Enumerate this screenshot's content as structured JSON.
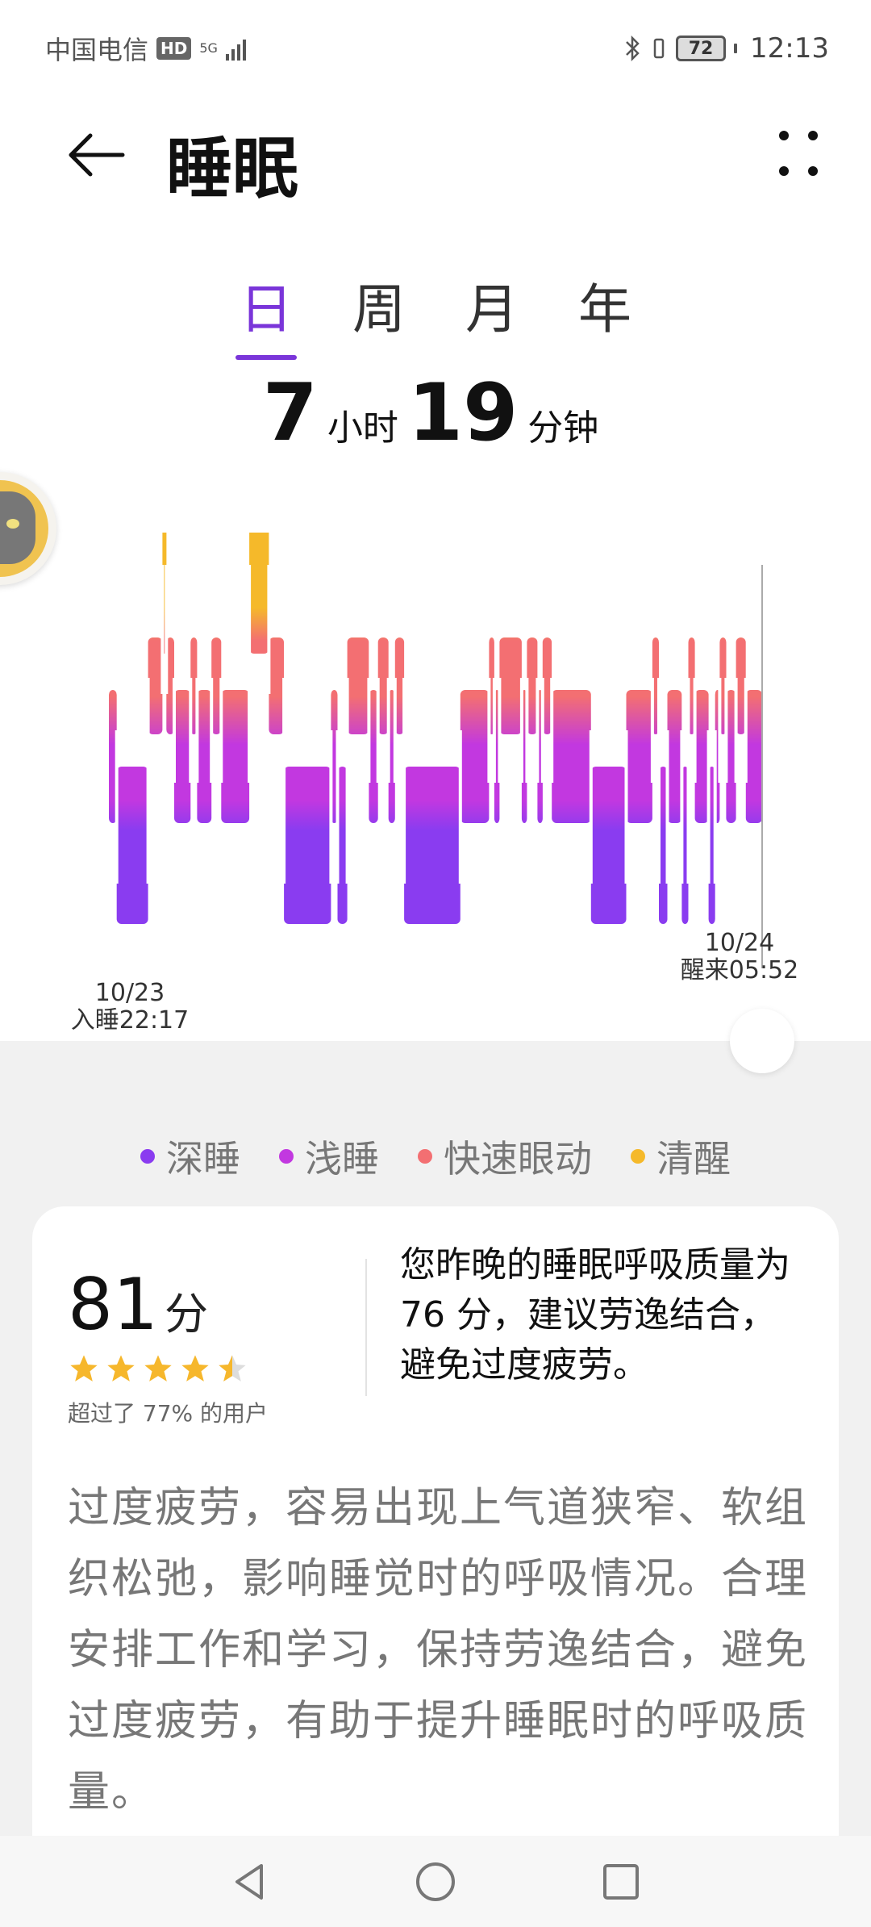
{
  "status_bar": {
    "carrier": "中国电信",
    "hd": "HD",
    "network": "5G",
    "battery": "72",
    "time": "12:13"
  },
  "header": {
    "title": "睡眠"
  },
  "tabs": [
    {
      "label": "日",
      "active": true
    },
    {
      "label": "周",
      "active": false
    },
    {
      "label": "月",
      "active": false
    },
    {
      "label": "年",
      "active": false
    }
  ],
  "duration": {
    "hours": "7",
    "hours_unit": "小时",
    "minutes": "19",
    "minutes_unit": "分钟"
  },
  "chart_data": {
    "type": "hypnogram",
    "start_date": "10/23",
    "start_label": "入睡22:17",
    "end_date": "10/24",
    "end_label": "醒来05:52",
    "stages_order": [
      "awake",
      "rem",
      "light",
      "deep"
    ],
    "segments": [
      {
        "stage": "light",
        "from": 0.0,
        "to": 0.012
      },
      {
        "stage": "deep",
        "from": 0.012,
        "to": 0.06
      },
      {
        "stage": "rem",
        "from": 0.06,
        "to": 0.082
      },
      {
        "stage": "awake",
        "from": 0.082,
        "to": 0.088
      },
      {
        "stage": "rem",
        "from": 0.088,
        "to": 0.1
      },
      {
        "stage": "light",
        "from": 0.1,
        "to": 0.125
      },
      {
        "stage": "rem",
        "from": 0.125,
        "to": 0.135
      },
      {
        "stage": "light",
        "from": 0.135,
        "to": 0.157
      },
      {
        "stage": "rem",
        "from": 0.157,
        "to": 0.172
      },
      {
        "stage": "light",
        "from": 0.172,
        "to": 0.215
      },
      {
        "stage": "awake",
        "from": 0.215,
        "to": 0.245
      },
      {
        "stage": "rem",
        "from": 0.245,
        "to": 0.268
      },
      {
        "stage": "deep",
        "from": 0.268,
        "to": 0.34
      },
      {
        "stage": "light",
        "from": 0.34,
        "to": 0.35
      },
      {
        "stage": "deep",
        "from": 0.35,
        "to": 0.365
      },
      {
        "stage": "rem",
        "from": 0.365,
        "to": 0.398
      },
      {
        "stage": "light",
        "from": 0.398,
        "to": 0.412
      },
      {
        "stage": "rem",
        "from": 0.412,
        "to": 0.428
      },
      {
        "stage": "light",
        "from": 0.428,
        "to": 0.438
      },
      {
        "stage": "rem",
        "from": 0.438,
        "to": 0.452
      },
      {
        "stage": "deep",
        "from": 0.452,
        "to": 0.538
      },
      {
        "stage": "light",
        "from": 0.538,
        "to": 0.582
      },
      {
        "stage": "rem",
        "from": 0.582,
        "to": 0.59
      },
      {
        "stage": "light",
        "from": 0.59,
        "to": 0.598
      },
      {
        "stage": "rem",
        "from": 0.598,
        "to": 0.632
      },
      {
        "stage": "light",
        "from": 0.632,
        "to": 0.64
      },
      {
        "stage": "rem",
        "from": 0.64,
        "to": 0.656
      },
      {
        "stage": "light",
        "from": 0.656,
        "to": 0.664
      },
      {
        "stage": "rem",
        "from": 0.664,
        "to": 0.678
      },
      {
        "stage": "light",
        "from": 0.678,
        "to": 0.738
      },
      {
        "stage": "deep",
        "from": 0.738,
        "to": 0.792
      },
      {
        "stage": "light",
        "from": 0.792,
        "to": 0.832
      },
      {
        "stage": "rem",
        "from": 0.832,
        "to": 0.842
      },
      {
        "stage": "deep",
        "from": 0.842,
        "to": 0.855
      },
      {
        "stage": "light",
        "from": 0.855,
        "to": 0.877
      },
      {
        "stage": "deep",
        "from": 0.877,
        "to": 0.887
      },
      {
        "stage": "rem",
        "from": 0.887,
        "to": 0.897
      },
      {
        "stage": "light",
        "from": 0.897,
        "to": 0.918
      },
      {
        "stage": "deep",
        "from": 0.918,
        "to": 0.928
      },
      {
        "stage": "light",
        "from": 0.928,
        "to": 0.935
      },
      {
        "stage": "rem",
        "from": 0.935,
        "to": 0.945
      },
      {
        "stage": "light",
        "from": 0.945,
        "to": 0.96
      },
      {
        "stage": "rem",
        "from": 0.96,
        "to": 0.975
      },
      {
        "stage": "light",
        "from": 0.975,
        "to": 1.0
      }
    ]
  },
  "legend": [
    {
      "label": "深睡",
      "color": "#8a3cf0"
    },
    {
      "label": "浅睡",
      "color": "#c238e0"
    },
    {
      "label": "快速眼动",
      "color": "#f36f72"
    },
    {
      "label": "清醒",
      "color": "#f5b92a"
    }
  ],
  "score_card": {
    "score": "81",
    "score_unit": "分",
    "stars": 4.5,
    "rank_text": "超过了 77% 的用户",
    "summary": "您昨晚的睡眠呼吸质量为 76 分，建议劳逸结合，避免过度疲劳。",
    "advice": "过度疲劳，容易出现上气道狭窄、软组织松弛，影响睡觉时的呼吸情况。合理安排工作和学习，保持劳逸结合，避免过度疲劳，有助于提升睡眠时的呼吸质量。"
  }
}
